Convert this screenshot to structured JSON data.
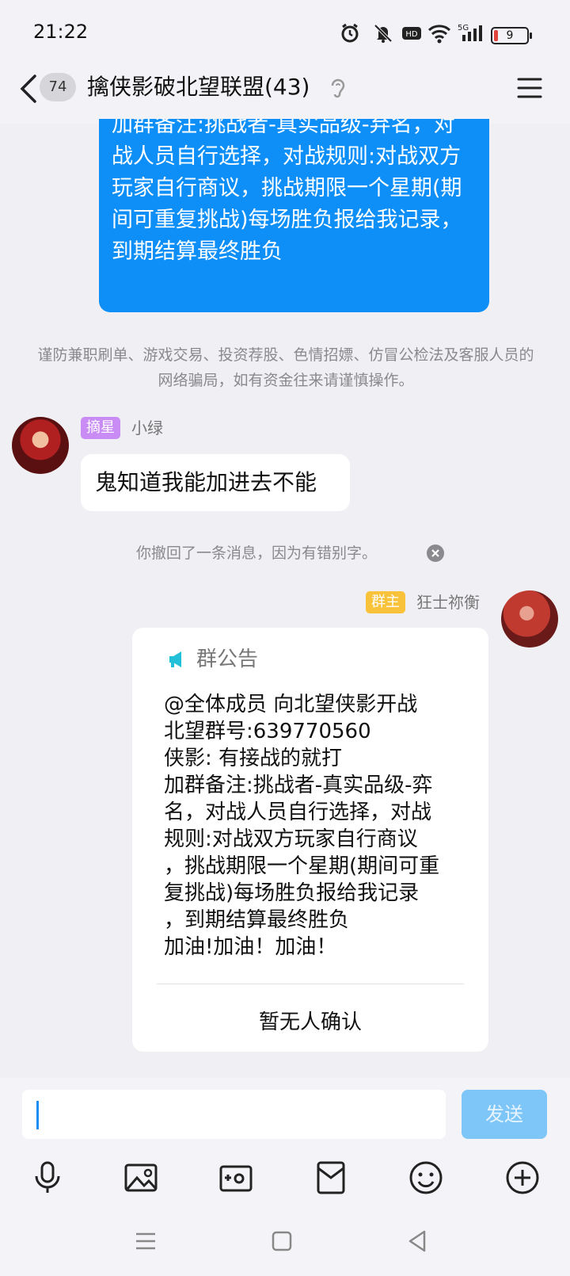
{
  "status_bar": {
    "time": "21:22",
    "battery_level": "9",
    "network": "5G"
  },
  "header": {
    "unread_count": "74",
    "title": "擒侠影破北望联盟(43)"
  },
  "messages": {
    "top_bubble_text": "加群备注:挑战者-真实品级-弃名，对战人员自行选择，对战规则:对战双方玩家自行商议，挑战期限一个星期(期间可重复挑战)每场胜负报给我记录，到期结算最终胜负",
    "warning_text": "谨防兼职刷单、游戏交易、投资荐股、色情招嫖、仿冒公检法及客服人员的网络骗局，如有资金往来请谨慎操作。",
    "msg1": {
      "badge": "摘星",
      "sender": "小绿",
      "text": "鬼知道我能加进去不能"
    },
    "recall_text": "你撤回了一条消息，因为有错别字。",
    "msg2": {
      "badge": "群主",
      "sender": "狂士祢衡"
    },
    "announcement": {
      "title": "群公告",
      "body": "@全体成员 向北望侠影开战\n北望群号:639770560\n侠影: 有接战的就打\n加群备注:挑战者-真实品级-弈\n名，对战人员自行选择，对战\n规则:对战双方玩家自行商议\n，挑战期限一个星期(期间可重\n复挑战)每场胜负报给我记录\n，到期结算最终胜负\n加油!加油！加油！",
      "footer": "暂无人确认"
    }
  },
  "input_bar": {
    "placeholder": "",
    "send_label": "发送"
  },
  "toolbar_icons": [
    "microphone-icon",
    "image-icon",
    "camera-icon",
    "red-packet-icon",
    "emoji-icon",
    "plus-icon"
  ],
  "colors": {
    "bubble_blue": "#0e8ff8",
    "send_button": "#7ec6f8",
    "badge_purple": "#c98cf5",
    "badge_gold": "#f8c23a"
  }
}
